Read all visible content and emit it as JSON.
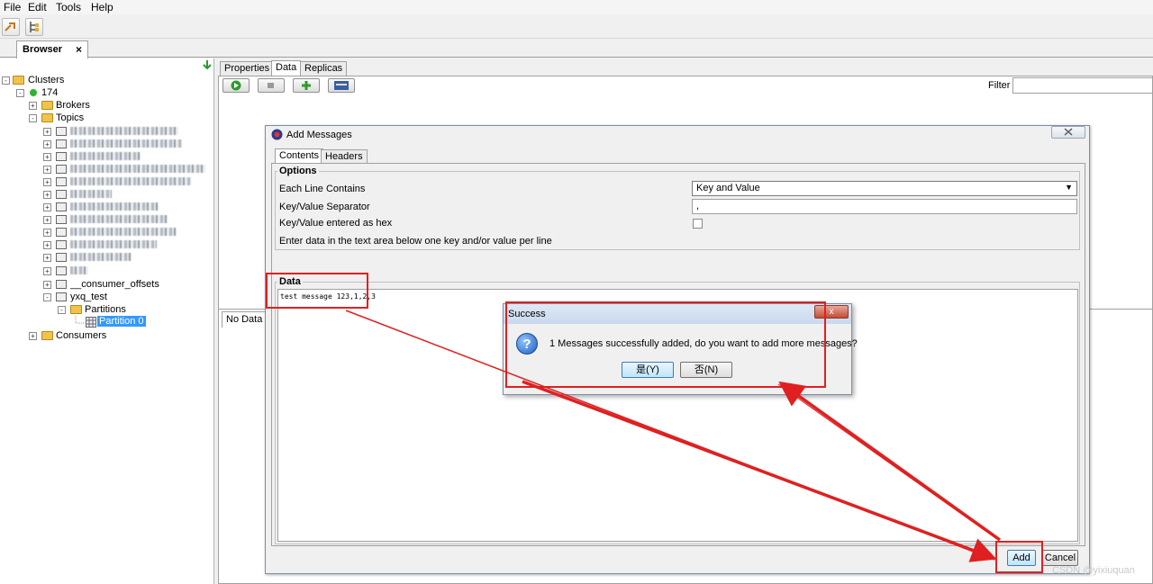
{
  "menu": {
    "file": "File",
    "edit": "Edit",
    "tools": "Tools",
    "help": "Help"
  },
  "browser_tab": {
    "label": "Browser",
    "close": "×"
  },
  "tree": {
    "clusters": "Clusters",
    "cluster_174": "174",
    "brokers": "Brokers",
    "topics": "Topics",
    "consumer_offsets": "__consumer_offsets",
    "yxq_test": "yxq_test",
    "partitions": "Partitions",
    "partition0": "Partition 0",
    "consumers": "Consumers",
    "expand_minus": "-",
    "expand_plus": "+"
  },
  "right": {
    "tabs": [
      "Properties",
      "Data",
      "Replicas"
    ],
    "filter_label": "Filter",
    "no_data_tab": "No Data"
  },
  "add_dialog": {
    "title": "Add Messages",
    "tabs": [
      "Contents",
      "Headers"
    ],
    "options_title": "Options",
    "each_line_label": "Each Line Contains",
    "each_line_value": "Key and Value",
    "separator_label": "Key/Value Separator",
    "separator_value": ",",
    "hex_label": "Key/Value entered as hex",
    "hint": "Enter data in the text area below one key and/or value per line",
    "data_title": "Data",
    "data_text": "test message 123,1,2,3",
    "add_button": "Add",
    "cancel_button": "Cancel"
  },
  "success_dialog": {
    "title": "Success",
    "message": "1 Messages successfully added, do you want to add more messages?",
    "yes_button": "是(Y)",
    "no_button": "否(N)",
    "close": "x"
  },
  "watermark": "CSDN @yixiuquan"
}
